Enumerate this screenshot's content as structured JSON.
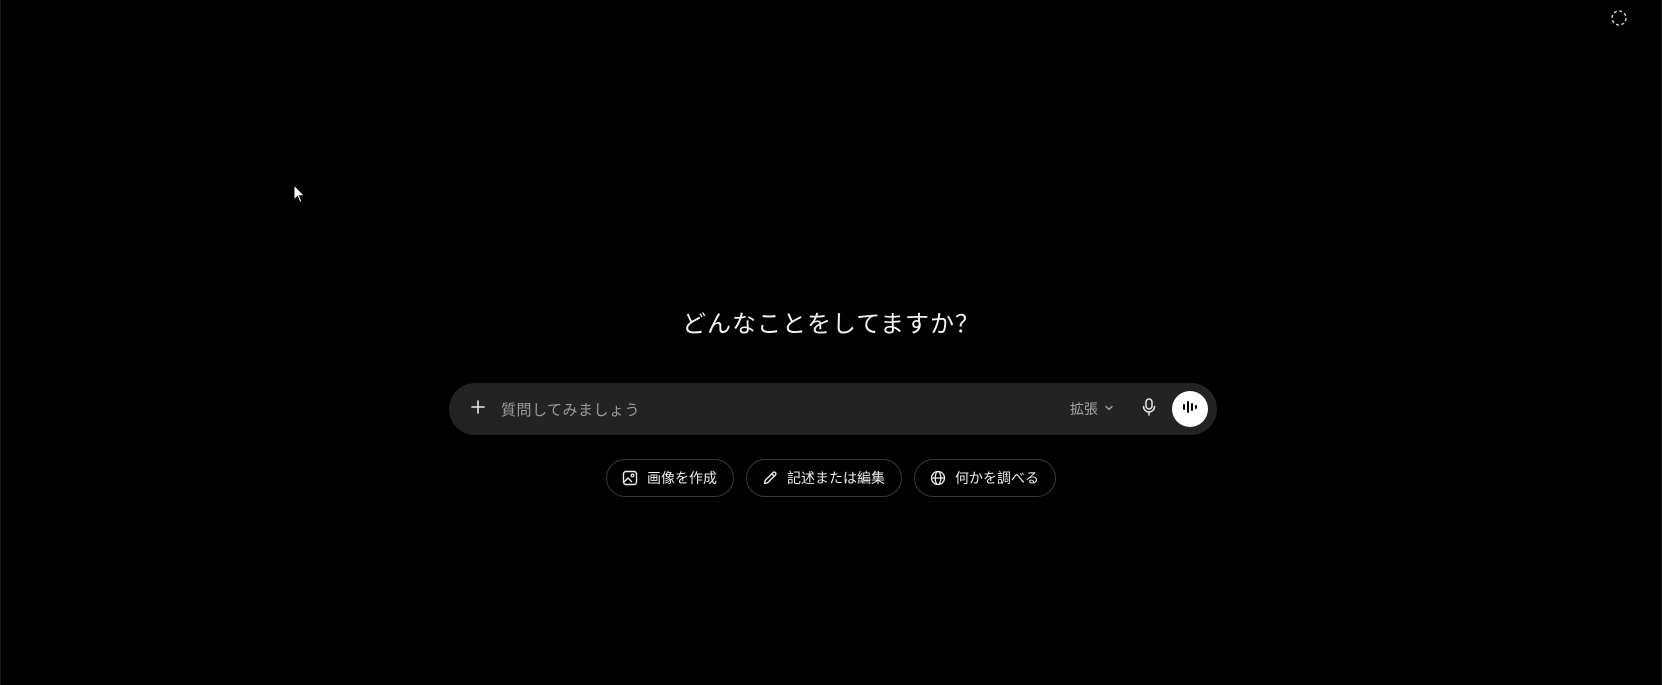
{
  "heading": "どんなことをしてますか？",
  "composer": {
    "placeholder": "質問してみましょう",
    "model_label": "拡張"
  },
  "chips": [
    {
      "label": "画像を作成",
      "icon": "image-icon"
    },
    {
      "label": "記述または編集",
      "icon": "pencil-icon"
    },
    {
      "label": "何かを調べる",
      "icon": "globe-icon"
    }
  ],
  "icons": {
    "top_right": "dashed-circle-icon",
    "plus": "plus-icon",
    "chevron": "chevron-down-icon",
    "mic": "mic-icon",
    "voice": "voice-waveform-icon"
  }
}
